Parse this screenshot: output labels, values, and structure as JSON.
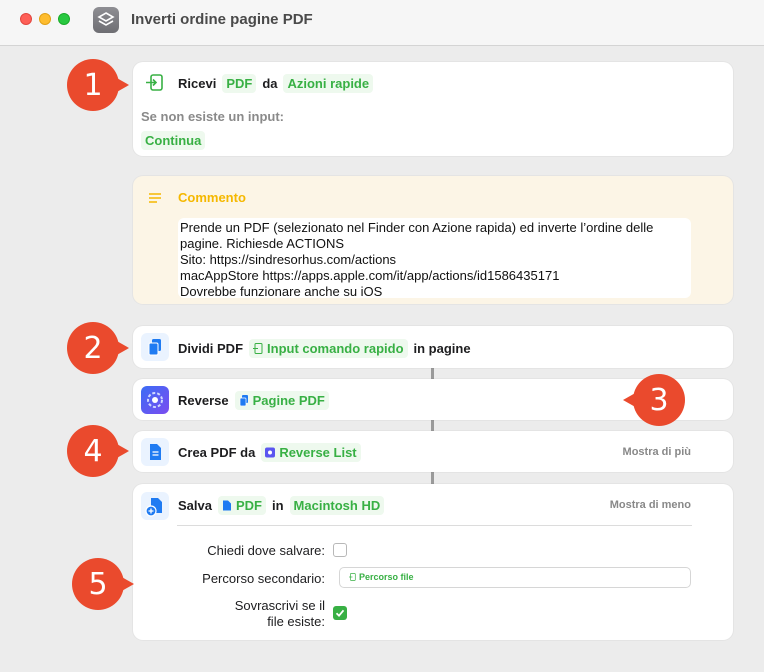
{
  "window": {
    "title": "Inverti ordine pagine PDF"
  },
  "colors": {
    "accent_green": "#38b044",
    "badge": "#ea4a2d",
    "comment_yellow": "#f5b800"
  },
  "step_badges": [
    "1",
    "2",
    "3",
    "4",
    "5"
  ],
  "receive": {
    "label": "Ricevi",
    "type_tag": "PDF",
    "from_label": "da",
    "source_tag": "Azioni rapide",
    "no_input_label": "Se non esiste un input:",
    "no_input_action": "Continua"
  },
  "comment": {
    "title": "Commento",
    "lines": [
      "Prende un PDF (selezionato nel Finder con Azione rapida) ed inverte l’ordine delle",
      "pagine. Richiesde ACTIONS",
      "Sito: https://sindresorhus.com/actions",
      "macAppStore https://apps.apple.com/it/app/actions/id1586435171",
      "Dovrebbe funzionare anche su iOS"
    ]
  },
  "split": {
    "label": "Dividi PDF",
    "input_tag": "Input comando rapido",
    "suffix": "in pagine"
  },
  "reverse": {
    "label": "Reverse",
    "input_tag": "Pagine PDF"
  },
  "make_pdf": {
    "label": "Crea PDF da",
    "input_tag": "Reverse List",
    "more": "Mostra di più"
  },
  "save": {
    "label": "Salva",
    "type_tag": "PDF",
    "in_label": "in",
    "destination_tag": "Macintosh HD",
    "less": "Mostra di meno",
    "ask_where_label": "Chiedi dove salvare:",
    "ask_where_checked": false,
    "subpath_label": "Percorso secondario:",
    "subpath_value": "Percorso file",
    "overwrite_label_line1": "Sovrascrivi se il",
    "overwrite_label_line2": "file esiste:",
    "overwrite_checked": true
  }
}
